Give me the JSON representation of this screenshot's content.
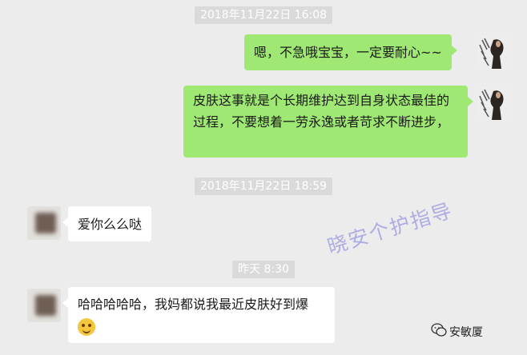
{
  "timestamps": [
    "2018年11月22日 16:08",
    "2018年11月22日 18:59",
    "昨天 8:30"
  ],
  "messages": [
    {
      "sender": "me",
      "text": "嗯，不急哦宝宝，一定要耐心~~"
    },
    {
      "sender": "me",
      "text": "皮肤这事就是个长期维护达到自身状态最佳的过程，不要想着一劳永逸或者苛求不断进步，"
    },
    {
      "sender": "other",
      "text": "爱你么么哒"
    },
    {
      "sender": "other",
      "text": "哈哈哈哈哈，我妈都说我最近皮肤好到爆",
      "emoji": "grinning-face-icon"
    }
  ],
  "watermark": "晓安个护指导",
  "brand": {
    "icon": "wechat-icon",
    "name": "安敏厦"
  },
  "colors": {
    "my_bubble": "#9fe873",
    "other_bubble": "#ffffff",
    "background": "#ececec",
    "timestamp_bg": "#dadada"
  }
}
